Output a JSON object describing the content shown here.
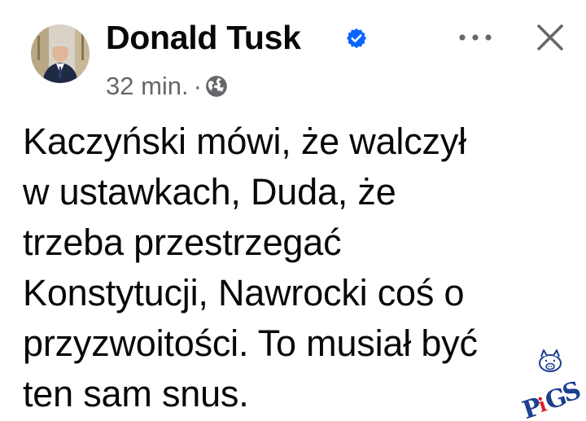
{
  "post": {
    "author": "Donald Tusk",
    "timestamp": "32 min.",
    "separator": "·",
    "audience_icon": "globe-icon",
    "verified_icon": "verified-badge-icon",
    "text": "Kaczyński mówi, że walczył\nw ustawkach, Duda, że\ntrzeba przestrzegać\nKonstytucji, Nawrocki coś o\nprzyzwoitości. To musiał być\nten sam snus."
  },
  "actions": {
    "more_icon": "more-options-icon",
    "close_icon": "close-icon"
  },
  "watermark": {
    "text": "PiGS"
  },
  "colors": {
    "text": "#080809",
    "secondary": "#65676b",
    "verified_blue": "#0866ff",
    "watermark_blue": "#1c3f8f",
    "watermark_red": "#d81f26"
  }
}
